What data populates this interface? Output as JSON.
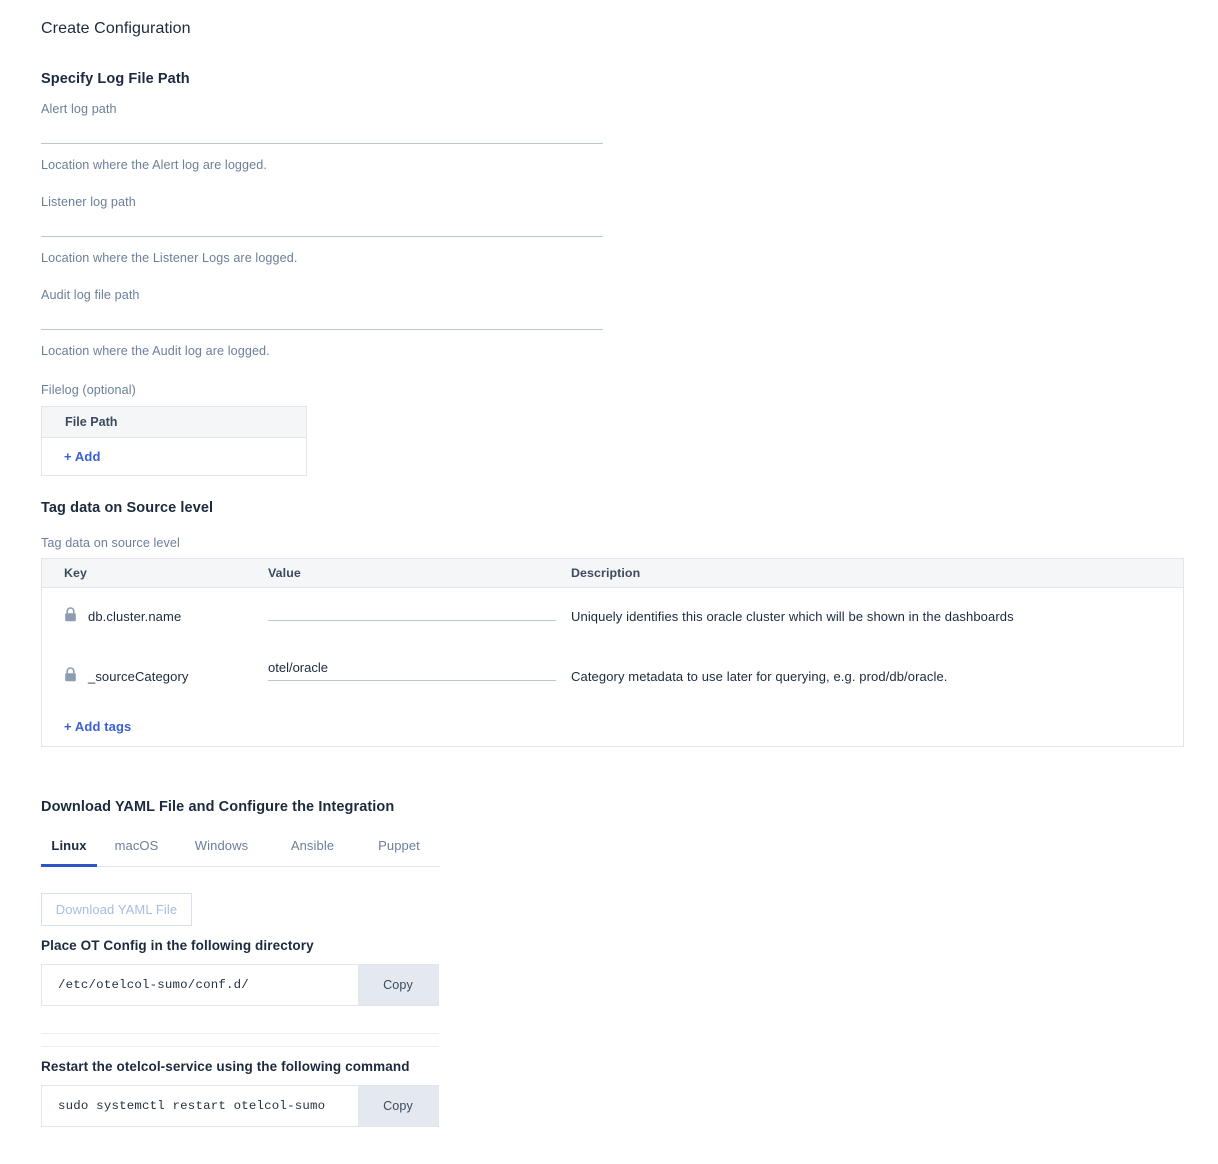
{
  "page": {
    "title": "Create Configuration"
  },
  "log_path_section": {
    "heading": "Specify Log File Path",
    "fields": [
      {
        "label": "Alert log path",
        "value": "",
        "placeholder": "",
        "help": "Location where the Alert log are logged."
      },
      {
        "label": "Listener log path",
        "value": "",
        "placeholder": "",
        "help": "Location where the Listener Logs are logged."
      },
      {
        "label": "Audit log file path",
        "value": "",
        "placeholder": "",
        "help": "Location where the Audit log are logged."
      }
    ],
    "filelog": {
      "label": "Filelog (optional)",
      "column_header": "File Path",
      "add_label": "+ Add"
    }
  },
  "tags_section": {
    "heading": "Tag data on Source level",
    "label": "Tag data on source level",
    "columns": [
      "Key",
      "Value",
      "Description"
    ],
    "rows": [
      {
        "key": "db.cluster.name",
        "value": "",
        "placeholder": "",
        "description": "Uniquely identifies this oracle cluster which will be shown in the dashboards",
        "locked": true
      },
      {
        "key": "_sourceCategory",
        "value": "otel/oracle",
        "placeholder": "",
        "description": "Category metadata to use later for querying, e.g. prod/db/oracle.",
        "locked": true
      }
    ],
    "add_tags_label": "+ Add tags"
  },
  "download_section": {
    "heading": "Download YAML File and Configure the Integration",
    "tabs": [
      {
        "label": "Linux",
        "active": true
      },
      {
        "label": "macOS",
        "active": false
      },
      {
        "label": "Windows",
        "active": false
      },
      {
        "label": "Ansible",
        "active": false
      },
      {
        "label": "Puppet",
        "active": false
      }
    ],
    "download_button": "Download YAML File",
    "config_dir": {
      "heading": "Place OT Config in the following directory",
      "command": "/etc/otelcol-sumo/conf.d/",
      "copy_label": "Copy"
    },
    "restart": {
      "heading": "Restart the otelcol-service using the following command",
      "command": "sudo systemctl restart otelcol-sumo",
      "copy_label": "Copy"
    }
  },
  "colors": {
    "accent": "#2f55c4",
    "link": "#3761d8",
    "text": "#1c2a3e",
    "muted": "#6b7f99",
    "border": "#e2e6ec",
    "header_bg": "#f5f6f8",
    "copy_bg": "#e4e9ef"
  }
}
